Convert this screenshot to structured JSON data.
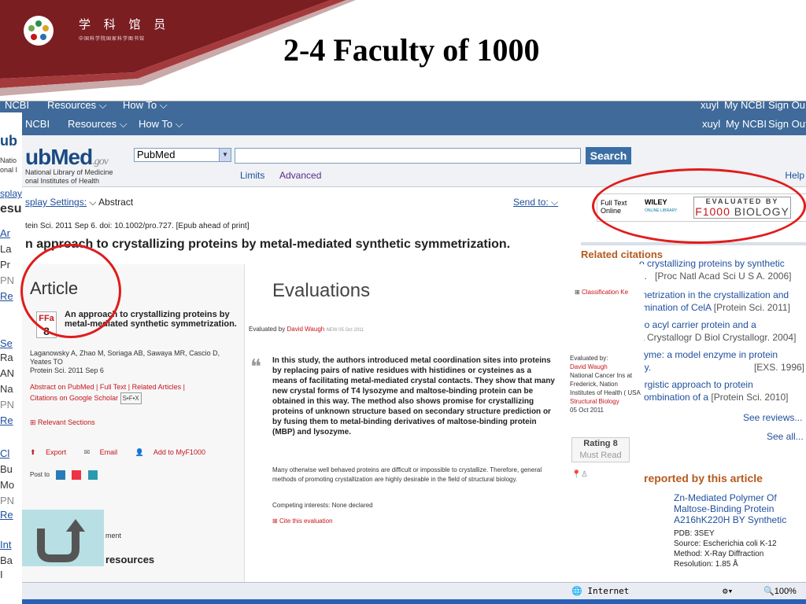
{
  "slide": {
    "title": "2-4 Faculty of 1000",
    "logo_zh": "学 科 馆 员",
    "logo_sub": "中国科学院国家科学图书馆",
    "colors": {
      "maroon": "#7a1e22",
      "accent_red": "#e01c1c",
      "ncbi_blue": "#3f6a9a"
    }
  },
  "back_window": {
    "ncbi": "NCBI",
    "resources": "Resources ⌵",
    "howto": "How To ⌵",
    "user": "xuyl",
    "my_ncbi": "My NCBI",
    "sign_out": "Sign Ou",
    "left_fragments": [
      "ub",
      "Natio",
      "onal I",
      "splay",
      "esu",
      "Ar",
      "La",
      "Pr",
      "PN",
      "Re",
      "Se",
      "Ra",
      "AN",
      "Na",
      "PN",
      "Re",
      "Cl",
      "Bu",
      "Mo",
      "PN",
      "Re",
      "Int",
      "Ba",
      "I"
    ]
  },
  "pubmed": {
    "topbar": {
      "ncbi": "NCBI",
      "resources": "Resources",
      "howto": "How To",
      "user": "xuyl",
      "my_ncbi": "My NCBI",
      "sign_out": "Sign Out"
    },
    "logo": {
      "main": "ubMed",
      "gov": ".gov",
      "nlm_line1": "National Library of Medicine",
      "nlm_line2": "onal Institutes of Health"
    },
    "search": {
      "database": "PubMed",
      "value": "",
      "button": "Search",
      "limits": "Limits",
      "advanced": "Advanced",
      "help": "Help"
    },
    "display_settings": "splay Settings:",
    "display_mode": "Abstract",
    "send_to": "Send to:",
    "citation": "tein Sci. 2011 Sep 6. doi: 10.1002/pro.727. [Epub ahead of print]",
    "citation_link": "tein Sci.",
    "article_title": "n approach to crystallizing proteins by metal-mediated synthetic symmetrization."
  },
  "sidebar": {
    "full_text_label": "Full Text Online",
    "wiley": "WILEY",
    "wiley_sub": "ONLINE LIBRARY",
    "f1000_top": "EVALUATED BY",
    "f1000_brand": "F1000",
    "f1000_suffix": "BIOLOGY",
    "related_heading": "Related citations",
    "related": [
      {
        "title": "o crystallizing proteins by synthetic",
        "title2": "n.",
        "source": "[Proc Natl Acad Sci U S A. 2006]"
      },
      {
        "title": "metrization in the crystallization and",
        "title2": "rmination of CelA",
        "source": "[Protein Sci. 2011]"
      },
      {
        "title": "po acyl carrier protein and a",
        "title2": "a Crystallogr D Biol Crystallogr. 2004]",
        "source": ""
      },
      {
        "title": "zyme: a model enzyme in protein",
        "title2": "ny.",
        "source": "[EXS. 1996]"
      },
      {
        "title": "ergistic approach to protein",
        "title2": "combination of a",
        "source": "[Protein Sci. 2010]"
      }
    ],
    "see_reviews": "See reviews...",
    "see_all": "See all...",
    "reported_heading": "reported by this article",
    "pdb_title": "Zn-Mediated Polymer Of Maltose-Binding Protein A216hK220H BY Synthetic",
    "pdb_id": "PDB: 3SEY",
    "pdb_source": "Source: Escherichia coli K-12",
    "pdb_method": "Method: X-Ray Diffraction",
    "pdb_resolution": "Resolution: 1.85 Å"
  },
  "f1000": {
    "article_heading": "Article",
    "badge_top": "FFa",
    "badge_score": "8",
    "article_title": "An approach to crystallizing proteins by metal-mediated synthetic symmetrization.",
    "authors": "Laganowsky A, Zhao M, Soriaga AB, Sawaya MR, Cascio D, Yeates TO",
    "journal": "Protein Sci. 2011 Sep 6",
    "links": "Abstract on PubMed | Full Text | Related Articles |",
    "scholar": "Citations on Google Scholar",
    "sfx": "S•F•X",
    "relevant": "Relevant Sections",
    "export": "Export",
    "email": "Email",
    "add": "Add to MyF1000",
    "post_to": "Post to",
    "evaluations_heading": "Evaluations",
    "evaluated_by_label": "Evaluated by",
    "evaluator": "David Waugh",
    "eval_date_small": "NEW 05 Oct 2011",
    "quote": "In this study, the authors introduced metal coordination sites into proteins by replacing pairs of native residues with histidines or cysteines as a means of facilitating metal-mediated crystal contacts. They show that many new crystal forms of T4 lysozyme and maltose-binding protein can be obtained in this way. The method also shows promise for crystallizing proteins of unknown structure based on secondary structure prediction or by fusing them to metal-binding derivatives of maltose-binding protein (MBP) and lysozyme.",
    "paragraph": "Many otherwise well behaved proteins are difficult or impossible to crystallize. Therefore, general methods of promoting crystallization are highly desirable in the field of structural biology.",
    "competing": "Competing interests: None declared",
    "cite_this": "Cite this evaluation",
    "classification": "Classification Ke",
    "evaluator_block_label": "Evaluated by:",
    "evaluator_affil": "National Cancer Ins at Frederick, Nation Institutes of Health ( USA",
    "faculty": "Structural Biology",
    "eval_date": "05 Oct 2011",
    "rating_label": "Rating 8",
    "rating_word": "Must Read",
    "comment_suffix": "ment",
    "resources_suffix": "resources"
  },
  "statusbar": {
    "zone": "Internet",
    "zoom": "100%"
  }
}
